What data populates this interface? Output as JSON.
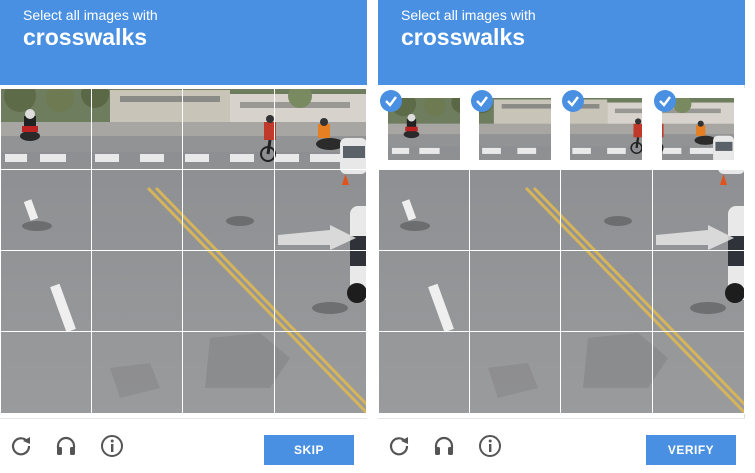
{
  "left": {
    "prompt_line1": "Select all images with",
    "prompt_line2": "crosswalks",
    "button_label": "SKIP"
  },
  "right": {
    "prompt_line1": "Select all images with",
    "prompt_line2": "crosswalks",
    "button_label": "VERIFY",
    "selected_tiles": [
      "row-1-col-1",
      "row-1-col-2",
      "row-1-col-3",
      "row-1-col-4"
    ]
  },
  "footer_icons": [
    "reload-icon",
    "audio-icon",
    "info-icon"
  ],
  "colors": {
    "accent": "#4a90e2",
    "tile_border": "#ffffff"
  }
}
